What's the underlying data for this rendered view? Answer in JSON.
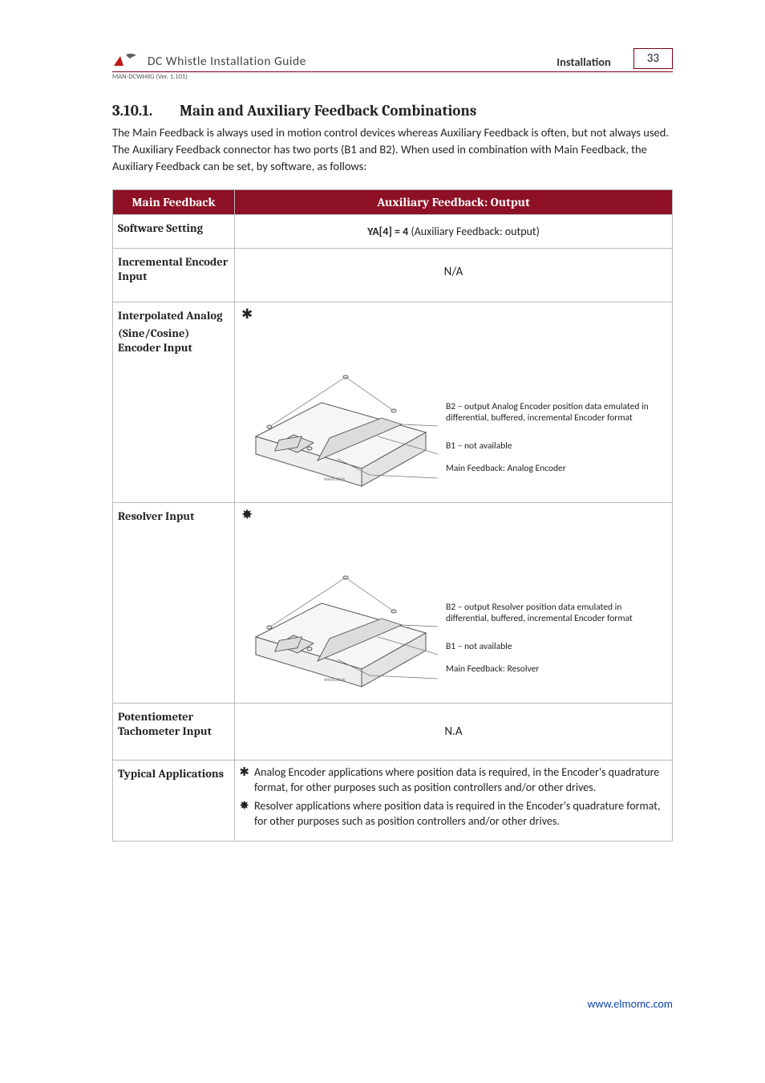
{
  "header": {
    "doc_title": "DC Whistle Installation Guide",
    "section_label": "Installation",
    "page_number": "33",
    "doc_code": "MAN-DCWHIIG (Ver. 1.101)"
  },
  "section": {
    "number": "3.10.1.",
    "title": "Main and Auxiliary Feedback Combinations",
    "intro": "The Main Feedback is always used in motion control devices whereas Auxiliary Feedback is often, but not always used. The Auxiliary Feedback connector has two ports (B1 and B2). When used in combination with Main Feedback, the Auxiliary Feedback can be set, by software, as follows:"
  },
  "table": {
    "col1_header": "Main Feedback",
    "col2_header": "Auxiliary Feedback: Output",
    "rows": {
      "software": {
        "label": "Software Setting",
        "key": "YA[4] = 4",
        "desc": " (Auxiliary Feedback: output)"
      },
      "incremental": {
        "label": "Incremental Encoder Input",
        "value": "N/A"
      },
      "analog": {
        "label_l1": "Interpolated Analog",
        "label_l2": "(Sine/Cosine) Encoder Input",
        "bullet": "✱",
        "callouts": {
          "b2": "B2 – output Analog Encoder position data emulated in differential, buffered, incremental Encoder format",
          "b1": "B1 – not available",
          "main": "Main Feedback: Analog Encoder"
        },
        "diagram_code": "WHDC003A"
      },
      "resolver": {
        "label": "Resolver Input",
        "bullet": "✸",
        "callouts": {
          "b2": "B2 – output Resolver position data emulated in differential, buffered, incremental Encoder format",
          "b1": "B1 – not available",
          "main": "Main Feedback: Resolver"
        },
        "diagram_code": "WHDC003A"
      },
      "pot": {
        "label": "Potentiometer Tachometer Input",
        "value": "N.A"
      },
      "apps": {
        "label": "Typical Applications",
        "items": [
          {
            "bullet": "✱",
            "text": "Analog Encoder applications where position data is required, in the Encoder's quadrature format, for other purposes such as position controllers and/or other drives."
          },
          {
            "bullet": "✸",
            "text": "Resolver applications where position data is required in the Encoder's quadrature format, for other purposes such as position controllers and/or other drives."
          }
        ]
      }
    }
  },
  "footer": {
    "link": "www.elmomc.com"
  }
}
